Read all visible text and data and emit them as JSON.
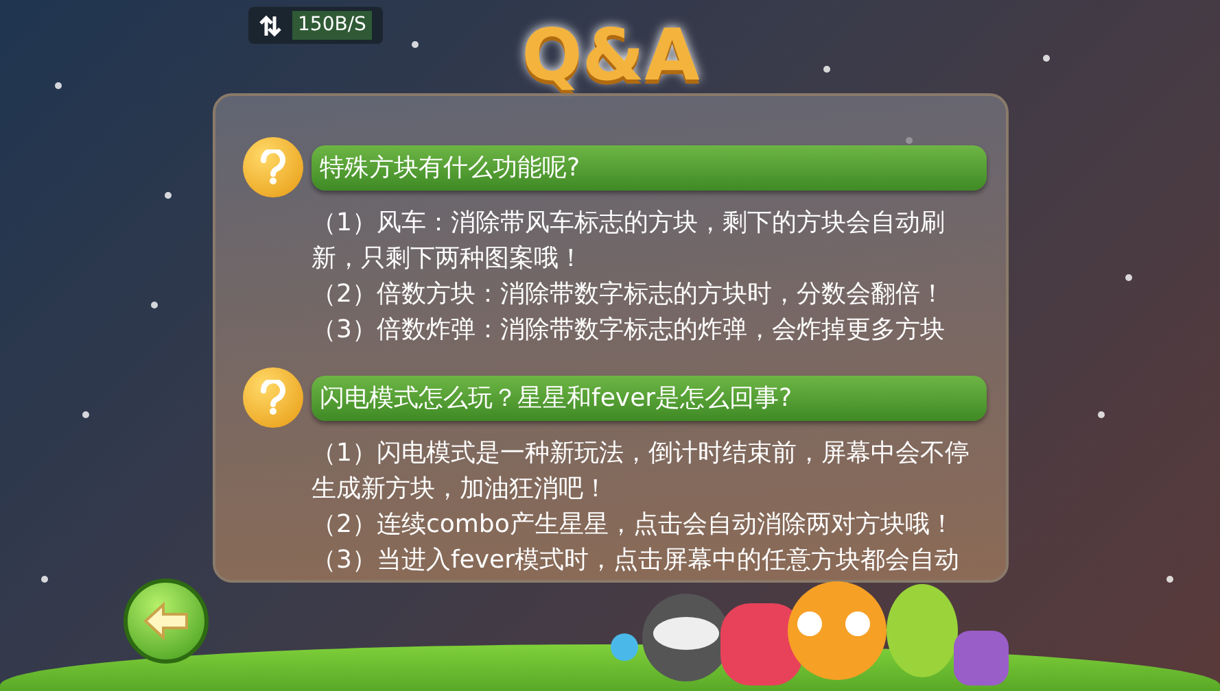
{
  "status_bar": {
    "net_speed": "150B/S"
  },
  "title": "Q&A",
  "faq": [
    {
      "question": "特殊方块有什么功能呢?",
      "answers": [
        "（1）风车：消除带风车标志的方块，剩下的方块会自动刷新，只剩下两种图案哦！",
        "（2）倍数方块：消除带数字标志的方块时，分数会翻倍！",
        "（3）倍数炸弹：消除带数字标志的炸弹，会炸掉更多方块"
      ]
    },
    {
      "question": "闪电模式怎么玩？星星和fever是怎么回事?",
      "answers": [
        "（1）闪电模式是一种新玩法，倒计时结束前，屏幕中会不停生成新方块，加油狂消吧！",
        "（2）连续combo产生星星，点击会自动消除两对方块哦！",
        "（3）当进入fever模式时，点击屏幕中的任意方块都会自动"
      ]
    }
  ]
}
